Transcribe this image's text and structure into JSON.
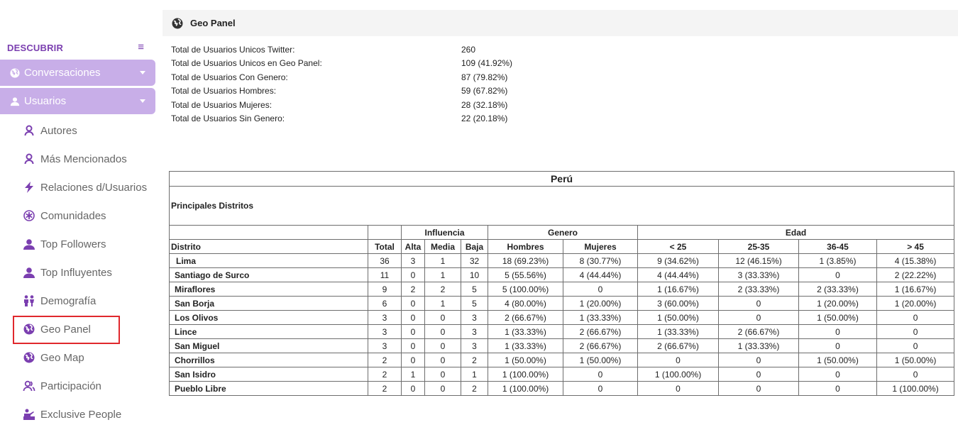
{
  "sidebar": {
    "section_title": "DESCUBRIR",
    "groups": [
      {
        "label": "Conversaciones",
        "icon": "globe-icon"
      },
      {
        "label": "Usuarios",
        "icon": "user-icon"
      }
    ],
    "items": [
      {
        "label": "Autores",
        "icon": "user-outline-icon"
      },
      {
        "label": "Más Mencionados",
        "icon": "user-outline-icon"
      },
      {
        "label": "Relaciones d/Usuarios",
        "icon": "bolt-icon"
      },
      {
        "label": "Comunidades",
        "icon": "asterisk-circle-icon"
      },
      {
        "label": "Top Followers",
        "icon": "user-icon"
      },
      {
        "label": "Top Influyentes",
        "icon": "user-icon"
      },
      {
        "label": "Demografía",
        "icon": "people-icon"
      },
      {
        "label": "Geo Panel",
        "icon": "globe-icon"
      },
      {
        "label": "Geo Map",
        "icon": "globe-icon"
      },
      {
        "label": "Participación",
        "icon": "users-outline-icon"
      },
      {
        "label": "Exclusive People",
        "icon": "presenter-icon"
      }
    ]
  },
  "header": {
    "title": "Geo Panel",
    "icon": "globe-icon"
  },
  "summary": [
    {
      "label": "Total de Usuarios Unicos Twitter:",
      "value": "260"
    },
    {
      "label": "Total de Usuarios Unicos en Geo Panel:",
      "value": "109 (41.92%)"
    },
    {
      "label": "Total de Usuarios Con Genero:",
      "value": "87 (79.82%)"
    },
    {
      "label": "Total de Usuarios Hombres:",
      "value": "59 (67.82%)"
    },
    {
      "label": "Total de Usuarios Mujeres:",
      "value": "28 (32.18%)"
    },
    {
      "label": "Total de Usuarios Sin Genero:",
      "value": "22 (20.18%)"
    }
  ],
  "table": {
    "country": "Perú",
    "subtitle": "Principales Distritos",
    "groups": {
      "influencia": "Influencia",
      "genero": "Genero",
      "edad": "Edad"
    },
    "columns": [
      "Distrito",
      "Total",
      "Alta",
      "Media",
      "Baja",
      "Hombres",
      "Mujeres",
      "< 25",
      "25-35",
      "36-45",
      "> 45"
    ],
    "rows": [
      [
        "Lima",
        "36",
        "3",
        "1",
        "32",
        "18 (69.23%)",
        "8 (30.77%)",
        "9 (34.62%)",
        "12 (46.15%)",
        "1 (3.85%)",
        "4 (15.38%)"
      ],
      [
        "Santiago de Surco",
        "11",
        "0",
        "1",
        "10",
        "5 (55.56%)",
        "4 (44.44%)",
        "4 (44.44%)",
        "3 (33.33%)",
        "0",
        "2 (22.22%)"
      ],
      [
        "Miraflores",
        "9",
        "2",
        "2",
        "5",
        "5 (100.00%)",
        "0",
        "1 (16.67%)",
        "2 (33.33%)",
        "2 (33.33%)",
        "1 (16.67%)"
      ],
      [
        "San Borja",
        "6",
        "0",
        "1",
        "5",
        "4 (80.00%)",
        "1 (20.00%)",
        "3 (60.00%)",
        "0",
        "1 (20.00%)",
        "1 (20.00%)"
      ],
      [
        "Los Olivos",
        "3",
        "0",
        "0",
        "3",
        "2 (66.67%)",
        "1 (33.33%)",
        "1 (50.00%)",
        "0",
        "1 (50.00%)",
        "0"
      ],
      [
        "Lince",
        "3",
        "0",
        "0",
        "3",
        "1 (33.33%)",
        "2 (66.67%)",
        "1 (33.33%)",
        "2 (66.67%)",
        "0",
        "0"
      ],
      [
        "San Miguel",
        "3",
        "0",
        "0",
        "3",
        "1 (33.33%)",
        "2 (66.67%)",
        "2 (66.67%)",
        "1 (33.33%)",
        "0",
        "0"
      ],
      [
        "Chorrillos",
        "2",
        "0",
        "0",
        "2",
        "1 (50.00%)",
        "1 (50.00%)",
        "0",
        "0",
        "1 (50.00%)",
        "1 (50.00%)"
      ],
      [
        "San Isidro",
        "2",
        "1",
        "0",
        "1",
        "1 (100.00%)",
        "0",
        "1 (100.00%)",
        "0",
        "0",
        "0"
      ],
      [
        "Pueblo Libre",
        "2",
        "0",
        "0",
        "2",
        "1 (100.00%)",
        "0",
        "0",
        "0",
        "0",
        "1 (100.00%)"
      ]
    ]
  },
  "colors": {
    "accent": "#7b3fb0",
    "group_bg": "#c8aee8",
    "highlight": "#e0282d"
  }
}
